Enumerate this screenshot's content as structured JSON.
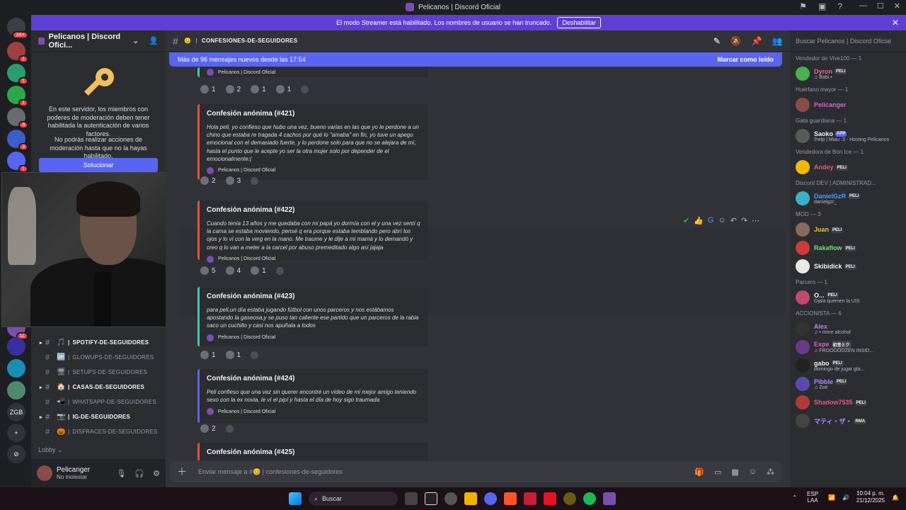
{
  "title": "Pelicanos | Discord Oficial",
  "banner": {
    "text": "El modo Streamer está habilitado. Los nombres de usuario se han truncado.",
    "button": "Deshabilitar"
  },
  "servers": [
    {
      "color": "#3c3f45",
      "badge": "1K+"
    },
    {
      "color": "#a04040",
      "badge": "1"
    },
    {
      "color": "#2a9d6e",
      "badge": "1"
    },
    {
      "color": "#2aa84a",
      "badge": "1"
    },
    {
      "color": "#6b6b6b",
      "badge": "3"
    },
    {
      "color": "#3a5fc8",
      "badge": "3"
    },
    {
      "color": "#5865f2",
      "badge": "1"
    }
  ],
  "servers_lower": [
    {
      "color": "#7a4fb0",
      "badge": "11"
    },
    {
      "color": "#3b2fa0",
      "badge": ""
    },
    {
      "color": "#1a8fb5",
      "badge": ""
    },
    {
      "color": "#4e8a6e",
      "badge": ""
    },
    {
      "text": "ZGB"
    },
    {
      "text": "+"
    },
    {
      "text": "⊘"
    }
  ],
  "sidebar": {
    "server_name": "Pelicanos | Discord Ofici...",
    "mfa_text": "En este servidor, los miembros con poderes de moderación deben tener habilitada la autenticación de varios factores.",
    "mfa_text2": "No podrás realizar acciones de moderación hasta que no la hayas habilitado.",
    "fix_button": "Solucionar",
    "channels": [
      {
        "name": "spotify-de-seguidores",
        "emoji": "🎵",
        "bold": true,
        "arrow": true
      },
      {
        "name": "glowups-de-seguidores",
        "emoji": "🆙",
        "bold": false,
        "arrow": false
      },
      {
        "name": "setups-de-seguidores",
        "emoji": "🖥",
        "bold": false,
        "arrow": false
      },
      {
        "name": "casas-de-seguidores",
        "emoji": "🏠",
        "bold": true,
        "arrow": true
      },
      {
        "name": "whatsapp-de-seguidores",
        "emoji": "📲",
        "bold": false,
        "arrow": false
      },
      {
        "name": "ig-de-seguidores",
        "emoji": "📷",
        "bold": true,
        "arrow": true
      },
      {
        "name": "disfraces-de-seguidores",
        "emoji": "🎃",
        "bold": false,
        "arrow": false
      }
    ],
    "lobby": "Lobby ⌄",
    "user": {
      "name": "Pelicanger",
      "status": "No molestar"
    }
  },
  "channel": {
    "name": "confesiones-de-seguidores",
    "new_messages": "Más de 96 mensajes nuevos desde las 17:54",
    "mark_read": "Marcar como leído",
    "composer_placeholder": "Enviar mensaje a #😊 | confesiones-de-seguidores"
  },
  "prev_footer": "Pelicanos | Discord Oficial",
  "embeds": [
    {
      "title": "Confesión anónima (#421)",
      "body": "Hola peli, yo confieso que hubo una vez, bueno varias en las que yo le perdone a un chino que estaba re tragada 4 cachos por qué lo \"amaba\" en fin, yo tuve un apego emocional con el demasiado fuerte, y lo perdone solo para que no se alejara de mí, hasta el punto que le acepte yo ser la otra mujer solo por depender de el emocionalmente:(",
      "footer": "Pelicanos | Discord Oficial",
      "color": "#e8503a"
    },
    {
      "title": "Confesión anónima (#422)",
      "body": "Cuando tenía 13 años y me quedaba con mi papá yo dormía con el y una vez sentí q la cama se estaba moviendo, pensé q era porque estaba temblando pero abrí los ojos y lo ví con la verg en la mano. Me traume y le dije a mi mamá y lo demandó y creo q lo van a meter a la carcel por abuso premeditado algo así jajaja",
      "footer": "Pelicanos | Discord Oficial",
      "color": "#e8503a"
    },
    {
      "title": "Confesión anónima (#423)",
      "body": "para peli,un día estaba jugando fútbol con unos parceros y nos estábamos apostando la gaseosa,y se puso tan caliente ese partido que un parceros de la rabia saco un cuchillo y casi nos apuñala a todos",
      "footer": "Pelicanos | Discord Oficial",
      "color": "#3ec9b0"
    },
    {
      "title": "Confesión anónima (#424)",
      "body": "Peli confieso que una vez sin querer encontré un vídeo de mi mejor amigo teniendo sexo con la ex novia, le ví el pipí y hasta el día de hoy sigo traumada",
      "footer": "Pelicanos | Discord Oficial",
      "color": "#5865f2"
    },
    {
      "title": "Confesión anónima (#425)",
      "body": "",
      "footer": "",
      "color": "#e8503a"
    }
  ],
  "reactions": [
    [
      "1",
      "2",
      "1",
      "1"
    ],
    [
      "2",
      "3"
    ],
    [
      "5",
      "4",
      "1"
    ],
    [
      "1",
      "1"
    ],
    [
      "2"
    ]
  ],
  "members": {
    "search": "Buscar Pelicanos | Discord Oficial",
    "groups": [
      {
        "title": "Vendedor de Vive100 — 1",
        "items": [
          {
            "name": "Dyron",
            "tag": "PELI",
            "sub": "♫ Babi •",
            "color": "#f06292",
            "av": "#4caf50"
          }
        ]
      },
      {
        "title": "Huérfano mayor — 1",
        "items": [
          {
            "name": "Pelicanger",
            "tag": "",
            "sub": "",
            "color": "#e05fd0",
            "av": "#8a4b4b"
          }
        ]
      },
      {
        "title": "Gata guardiana — 1",
        "items": [
          {
            "name": "Saoko",
            "tag": "APP",
            "sub": "!help | Miau :3 - Hosting Pelicanos",
            "color": "#f2f3f5",
            "av": "#5a5a5a"
          }
        ]
      },
      {
        "title": "Vendedora de Bon Ice — 1",
        "items": [
          {
            "name": "Andey",
            "tag": "PELI",
            "sub": "",
            "color": "#e85a7a",
            "av": "#f5b800"
          }
        ]
      },
      {
        "title": "Discord DEV | ADMINISTRAD...",
        "items": [
          {
            "name": "DanielGzR",
            "tag": "PELI",
            "sub": "danielgzr_",
            "color": "#4f9bff",
            "av": "#3ab0c8"
          }
        ]
      },
      {
        "title": "MOD — 3",
        "items": [
          {
            "name": "Juan",
            "tag": "PELI",
            "sub": "",
            "color": "#e8c24a",
            "av": "#8a6a5a"
          },
          {
            "name": "Rakaflow",
            "tag": "PELI",
            "sub": "",
            "color": "#6ee07a",
            "av": "#d03a3a"
          },
          {
            "name": "Skibidick",
            "tag": "PELI",
            "sub": "",
            "color": "#f2f3f5",
            "av": "#e8e8e8"
          }
        ]
      },
      {
        "title": "Parcero — 1",
        "items": [
          {
            "name": "O...",
            "tag": "PELI",
            "sub": "Ojala quemen la UIS",
            "color": "#f2f3f5",
            "av": "#c04a6a"
          }
        ]
      },
      {
        "title": "ACCIONISTA — 6",
        "items": [
          {
            "name": "Alex",
            "tag": "",
            "sub": "♫ • more alcohol",
            "color": "#b388ff",
            "av": "#333"
          },
          {
            "name": "Expe",
            "tag": "初音ミク",
            "sub": "♫ FROOOOOZEN INSID...",
            "color": "#e05fd0",
            "av": "#6a3a8a"
          },
          {
            "name": "gabo",
            "tag": "PELI",
            "sub": "domingo de jugar gta...",
            "color": "#f2f3f5",
            "av": "#222"
          },
          {
            "name": "Pibble",
            "tag": "PELI",
            "sub": "♫ Zoé",
            "color": "#b388ff",
            "av": "#5a4ab0"
          },
          {
            "name": "Shadow7535",
            "tag": "PELI",
            "sub": "",
            "color": "#e85a7a",
            "av": "#b03a3a"
          },
          {
            "name": "マティ・ザ・",
            "tag": "RMA",
            "sub": "",
            "color": "#b388ff",
            "av": "#444"
          }
        ]
      }
    ]
  },
  "taskbar": {
    "search": "Buscar",
    "lang": "ESP LAA",
    "time": "10:04 p. m.",
    "date": "21/12/2025"
  }
}
